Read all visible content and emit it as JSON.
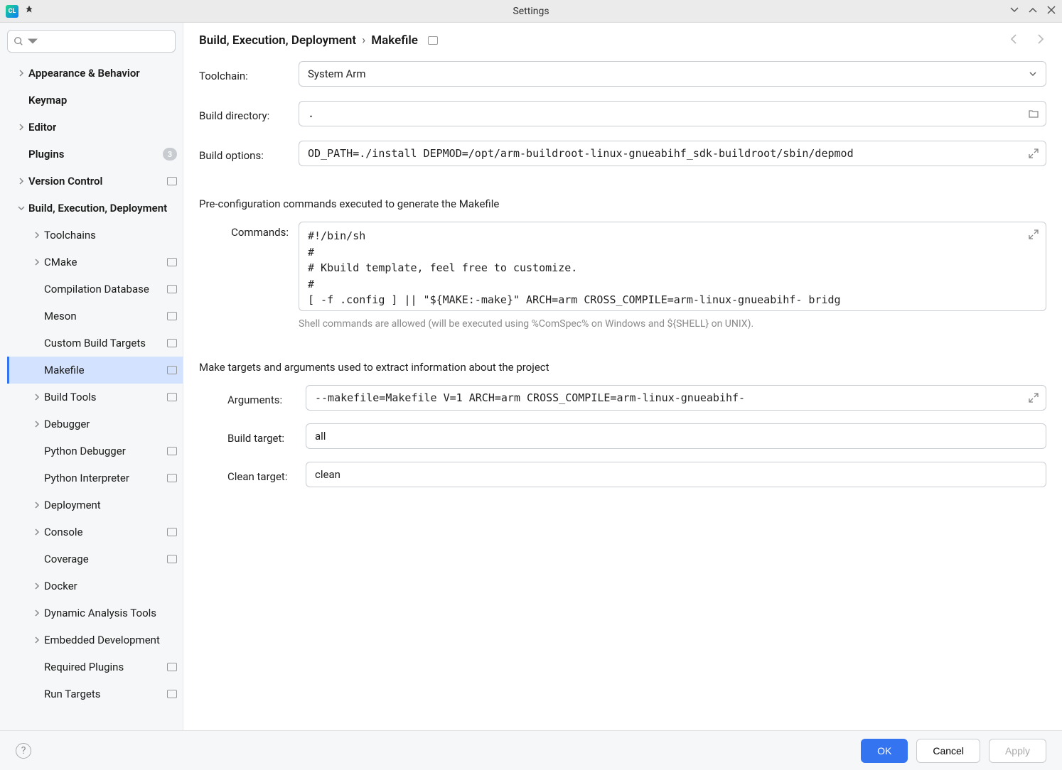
{
  "window": {
    "title": "Settings"
  },
  "sidebar": {
    "search_placeholder": "",
    "items": [
      {
        "label": "Appearance & Behavior",
        "bold": true,
        "chev": ">",
        "lvl": 1
      },
      {
        "label": "Keymap",
        "bold": true,
        "chev": "",
        "lvl": 1
      },
      {
        "label": "Editor",
        "bold": true,
        "chev": ">",
        "lvl": 1
      },
      {
        "label": "Plugins",
        "bold": true,
        "chev": "",
        "lvl": 1,
        "badge": "3"
      },
      {
        "label": "Version Control",
        "bold": true,
        "chev": ">",
        "lvl": 1,
        "proj": true
      },
      {
        "label": "Build, Execution, Deployment",
        "bold": true,
        "chev": "v",
        "lvl": 1
      },
      {
        "label": "Toolchains",
        "bold": false,
        "chev": ">",
        "lvl": 2
      },
      {
        "label": "CMake",
        "bold": false,
        "chev": ">",
        "lvl": 2,
        "proj": true
      },
      {
        "label": "Compilation Database",
        "bold": false,
        "chev": "",
        "lvl": 2,
        "proj": true
      },
      {
        "label": "Meson",
        "bold": false,
        "chev": "",
        "lvl": 2,
        "proj": true
      },
      {
        "label": "Custom Build Targets",
        "bold": false,
        "chev": "",
        "lvl": 2,
        "proj": true
      },
      {
        "label": "Makefile",
        "bold": false,
        "chev": "",
        "lvl": 2,
        "proj": true,
        "selected": true
      },
      {
        "label": "Build Tools",
        "bold": false,
        "chev": ">",
        "lvl": 2,
        "proj": true
      },
      {
        "label": "Debugger",
        "bold": false,
        "chev": ">",
        "lvl": 2
      },
      {
        "label": "Python Debugger",
        "bold": false,
        "chev": "",
        "lvl": 2,
        "proj": true
      },
      {
        "label": "Python Interpreter",
        "bold": false,
        "chev": "",
        "lvl": 2,
        "proj": true
      },
      {
        "label": "Deployment",
        "bold": false,
        "chev": ">",
        "lvl": 2
      },
      {
        "label": "Console",
        "bold": false,
        "chev": ">",
        "lvl": 2,
        "proj": true
      },
      {
        "label": "Coverage",
        "bold": false,
        "chev": "",
        "lvl": 2,
        "proj": true
      },
      {
        "label": "Docker",
        "bold": false,
        "chev": ">",
        "lvl": 2
      },
      {
        "label": "Dynamic Analysis Tools",
        "bold": false,
        "chev": ">",
        "lvl": 2
      },
      {
        "label": "Embedded Development",
        "bold": false,
        "chev": ">",
        "lvl": 2
      },
      {
        "label": "Required Plugins",
        "bold": false,
        "chev": "",
        "lvl": 2,
        "proj": true
      },
      {
        "label": "Run Targets",
        "bold": false,
        "chev": "",
        "lvl": 2,
        "proj": true
      }
    ]
  },
  "breadcrumb": {
    "parent": "Build, Execution, Deployment",
    "current": "Makefile"
  },
  "form": {
    "toolchain_label": "Toolchain:",
    "toolchain_value": "System Arm",
    "build_dir_label": "Build directory:",
    "build_dir_value": ".",
    "build_opts_label": "Build options:",
    "build_opts_value": "OD_PATH=./install DEPMOD=/opt/arm-buildroot-linux-gnueabihf_sdk-buildroot/sbin/depmod",
    "precfg_section": "Pre-configuration commands executed to generate the Makefile",
    "commands_label": "Commands:",
    "commands_value": "#!/bin/sh\n#\n# Kbuild template, feel free to customize.\n#\n[ -f .config ] || \"${MAKE:-make}\" ARCH=arm CROSS_COMPILE=arm-linux-gnueabihf- bridg",
    "commands_hint": "Shell commands are allowed (will be executed using %ComSpec% on Windows and ${SHELL} on UNIX).",
    "targets_section": "Make targets and arguments used to extract information about the project",
    "arguments_label": "Arguments:",
    "arguments_value": "--makefile=Makefile V=1 ARCH=arm CROSS_COMPILE=arm-linux-gnueabihf-",
    "build_target_label": "Build target:",
    "build_target_value": "all",
    "clean_target_label": "Clean target:",
    "clean_target_value": "clean"
  },
  "footer": {
    "ok": "OK",
    "cancel": "Cancel",
    "apply": "Apply"
  }
}
